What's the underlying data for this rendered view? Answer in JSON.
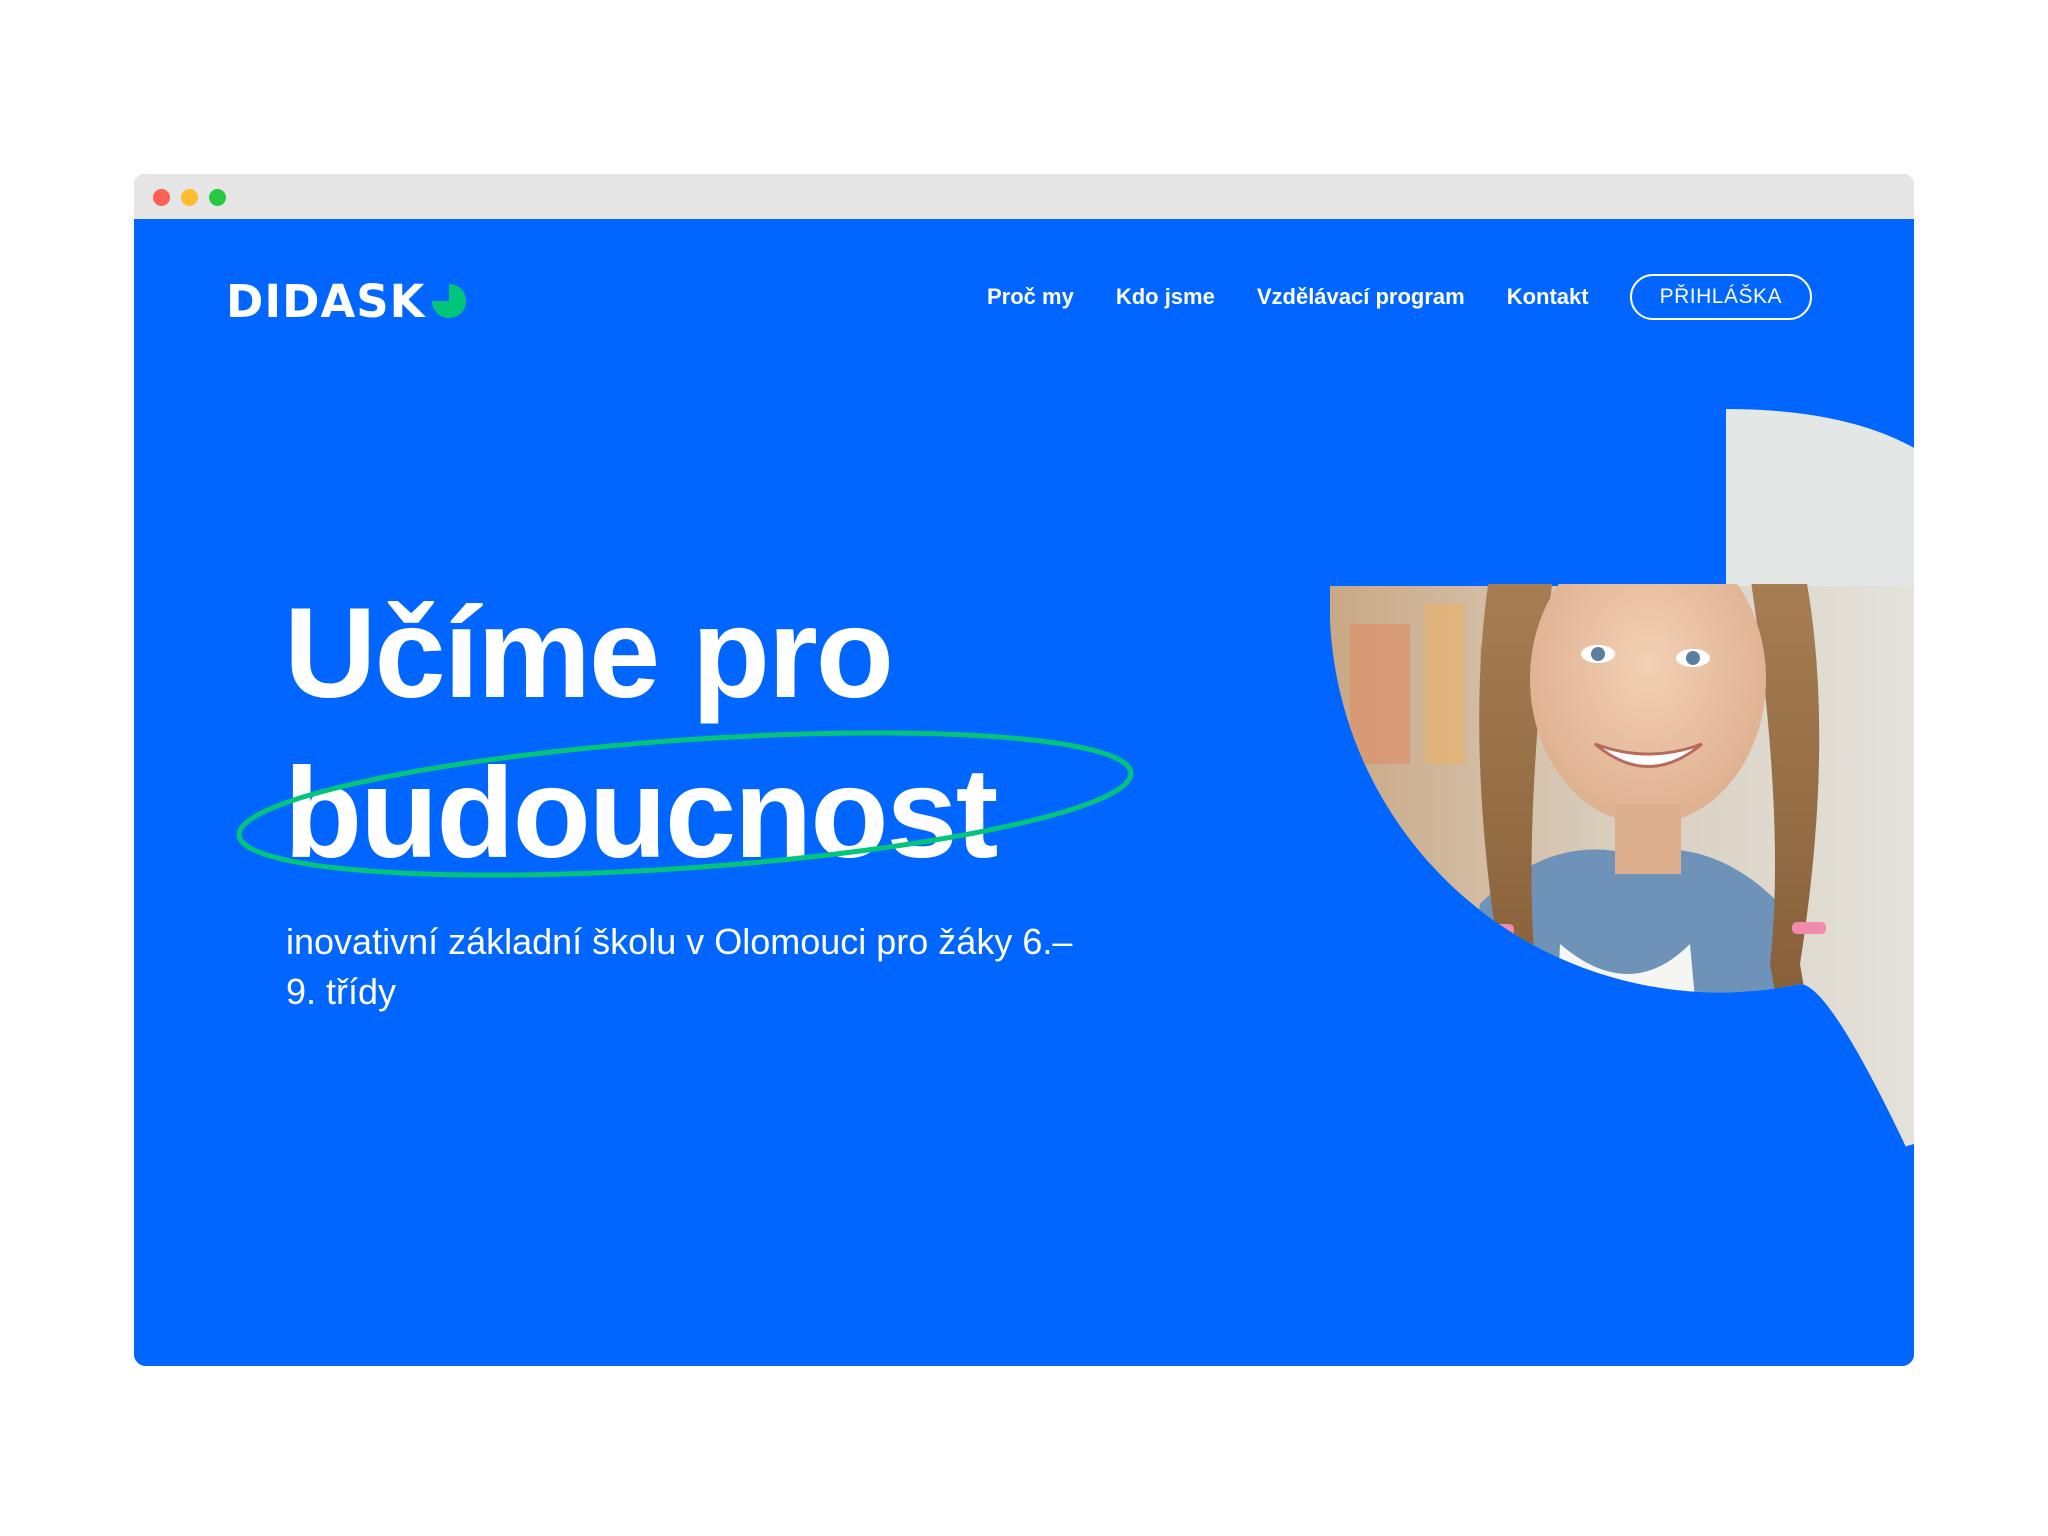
{
  "brand": {
    "logo_text": "DIDASK",
    "accent_color": "#00c57a",
    "primary_color": "#0066ff"
  },
  "nav": {
    "items": [
      {
        "label": "Proč my"
      },
      {
        "label": "Kdo jsme"
      },
      {
        "label": "Vzdělávací program"
      },
      {
        "label": "Kontakt"
      }
    ],
    "cta_label": "PŘIHLÁŠKA"
  },
  "hero": {
    "title_line1": "Učíme pro",
    "title_line2": "budoucnost",
    "subtitle": "inovativní základní školu v Olomouci pro žáky 6.–9. třídy",
    "image_icon": "student-girl-photo"
  }
}
